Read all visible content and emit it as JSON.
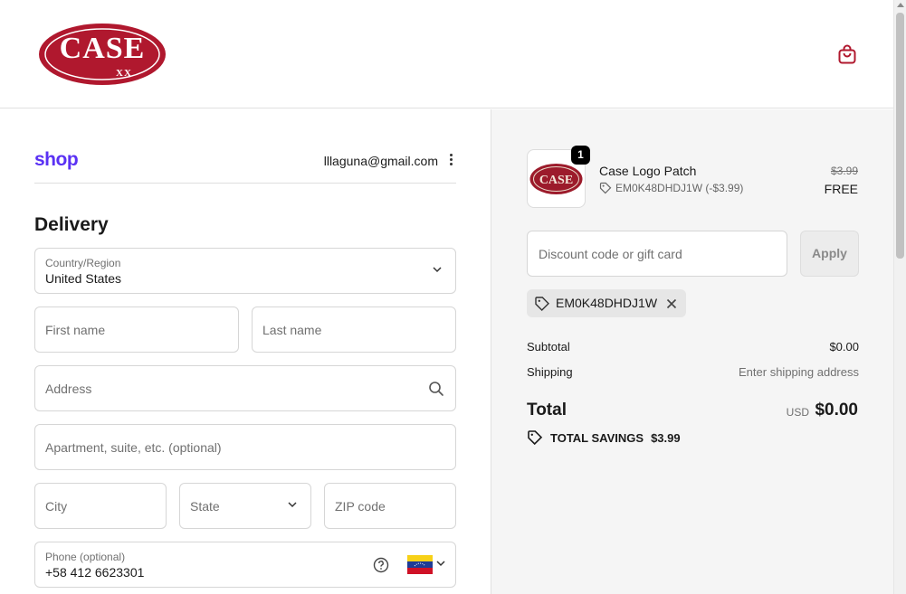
{
  "brand": {
    "logo_text": "CASE",
    "logo_sub": "XX",
    "logo_color": "#b0182e"
  },
  "header": {
    "cart_icon": "shopping-bag-icon"
  },
  "account": {
    "shop_logo": "shop",
    "email": "lllaguna@gmail.com",
    "menu_icon": "kebab-icon"
  },
  "delivery": {
    "title": "Delivery",
    "country_label": "Country/Region",
    "country_value": "United States",
    "first_name_placeholder": "First name",
    "last_name_placeholder": "Last name",
    "address_placeholder": "Address",
    "apartment_placeholder": "Apartment, suite, etc. (optional)",
    "city_placeholder": "City",
    "state_placeholder": "State",
    "zip_placeholder": "ZIP code",
    "phone_label": "Phone (optional)",
    "phone_value": "+58 412 6623301"
  },
  "summary": {
    "item": {
      "quantity": "1",
      "name": "Case Logo Patch",
      "discount": "EM0K48DHDJ1W (-$3.99)",
      "original_price": "$3.99",
      "price": "FREE"
    },
    "discount_placeholder": "Discount code or gift card",
    "apply_label": "Apply",
    "applied_code": "EM0K48DHDJ1W",
    "subtotal_label": "Subtotal",
    "subtotal_value": "$0.00",
    "shipping_label": "Shipping",
    "shipping_value": "Enter shipping address",
    "total_label": "Total",
    "currency": "USD",
    "total_value": "$0.00",
    "savings_label": "TOTAL SAVINGS",
    "savings_value": "$3.99"
  },
  "colors": {
    "shop_purple": "#5a31f4",
    "panel_bg": "#f5f5f5",
    "accent_red": "#b0182e"
  }
}
